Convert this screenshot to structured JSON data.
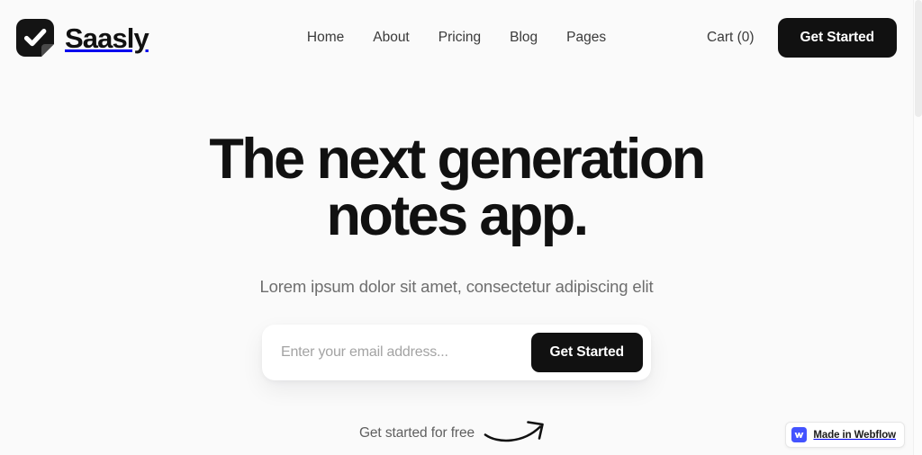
{
  "header": {
    "brand": {
      "name": "Saasly",
      "logo_icon": "checkmark-rounded-square-icon"
    },
    "nav": [
      {
        "label": "Home"
      },
      {
        "label": "About"
      },
      {
        "label": "Pricing"
      },
      {
        "label": "Blog"
      },
      {
        "label": "Pages"
      }
    ],
    "cart_label": "Cart (0)",
    "cta_label": "Get Started"
  },
  "hero": {
    "title_line1": "The next generation",
    "title_line2": "notes app.",
    "subtitle": "Lorem ipsum dolor sit amet, consectetur adipiscing elit"
  },
  "signup_form": {
    "email_placeholder": "Enter your email address...",
    "email_value": "",
    "submit_label": "Get Started"
  },
  "free_cta": {
    "text": "Get started for free",
    "arrow_icon": "curved-arrow-up-right-icon"
  },
  "webflow_badge": {
    "text": "Made in Webflow",
    "icon": "webflow-w-icon"
  },
  "colors": {
    "page_background": "#fafafa",
    "text_primary": "#111111",
    "text_muted": "#6e6e6e",
    "accent_dark": "#111111",
    "card_background": "#ffffff",
    "webflow_blue": "#4353ff"
  }
}
